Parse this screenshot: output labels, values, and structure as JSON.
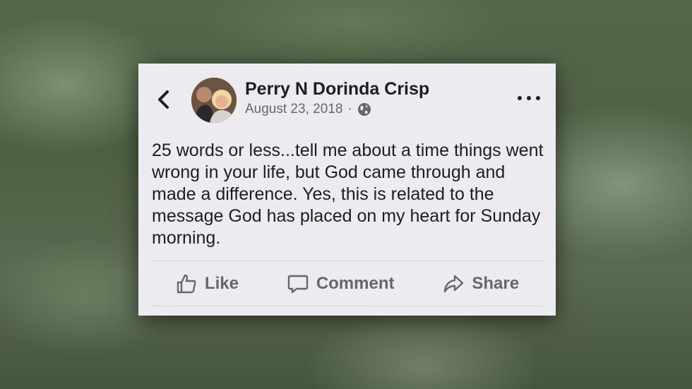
{
  "post": {
    "author": "Perry N Dorinda Crisp",
    "date": "August 23, 2018",
    "separator": "·",
    "privacy_icon": "globe-icon",
    "text": "25 words or less...tell me about a time things went wrong in your life, but God came through and made a difference. Yes, this is related to the message God has placed on my heart for Sunday morning."
  },
  "actions": {
    "like_label": "Like",
    "comment_label": "Comment",
    "share_label": "Share"
  },
  "icons": {
    "back": "chevron-left-icon",
    "more": "more-options-icon",
    "like": "thumbs-up-icon",
    "comment": "speech-bubble-icon",
    "share": "share-arrow-icon"
  },
  "colors": {
    "card_background": "#ecebef",
    "primary_text": "#1c1e21",
    "secondary_text": "#65676b"
  }
}
